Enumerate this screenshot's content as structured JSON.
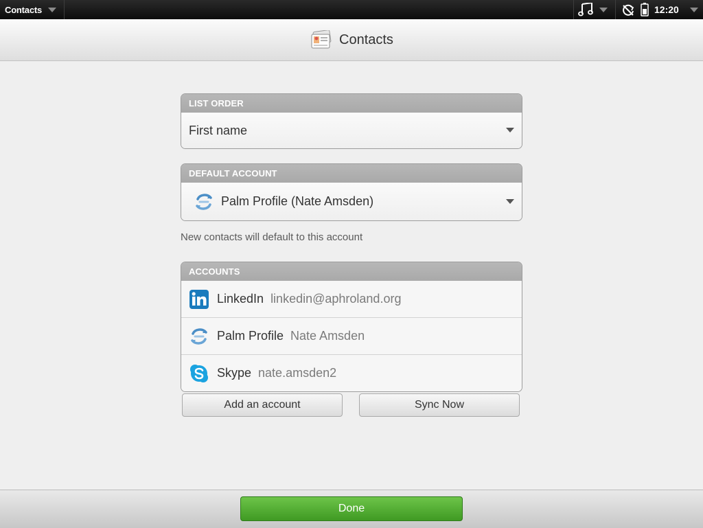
{
  "status_bar": {
    "app_name": "Contacts",
    "time": "12:20"
  },
  "header": {
    "title": "Contacts"
  },
  "list_order": {
    "header": "LIST ORDER",
    "value": "First name"
  },
  "default_account": {
    "header": "DEFAULT ACCOUNT",
    "value": "Palm Profile (Nate Amsden)",
    "hint": "New contacts will default to this account"
  },
  "accounts": {
    "header": "ACCOUNTS",
    "items": [
      {
        "name": "LinkedIn",
        "user": "linkedin@aphroland.org",
        "icon": "linkedin-icon"
      },
      {
        "name": "Palm Profile",
        "user": "Nate Amsden",
        "icon": "palm-profile-icon"
      },
      {
        "name": "Skype",
        "user": "nate.amsden2",
        "icon": "skype-icon"
      }
    ]
  },
  "buttons": {
    "add_account": "Add an account",
    "sync_now": "Sync Now",
    "done": "Done"
  },
  "colors": {
    "done_green": "#4caf2c",
    "group_header": "#b0b0b0",
    "linkedin_blue": "#1a7bbd",
    "skype_blue": "#1ba3e0"
  }
}
